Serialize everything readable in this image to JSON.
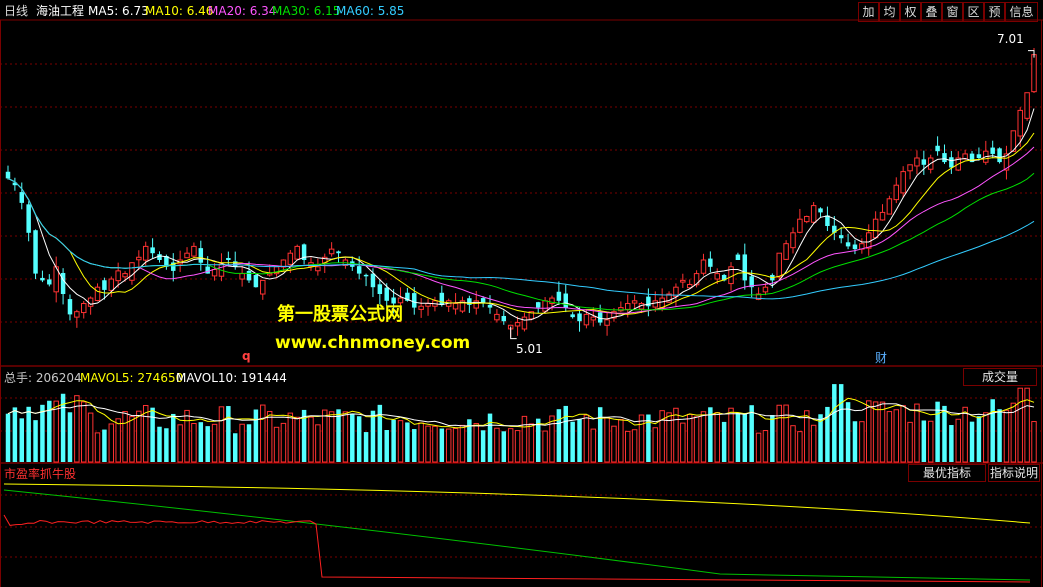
{
  "price_panel": {
    "period": "日线",
    "stock_name": "海油工程",
    "ma_items": [
      {
        "label": "MA5: 6.73",
        "color": "#ffffff"
      },
      {
        "label": "MA10: 6.46",
        "color": "#ffff00"
      },
      {
        "label": "MA20: 6.34",
        "color": "#ff55ff"
      },
      {
        "label": "MA30: 6.15",
        "color": "#00e000"
      },
      {
        "label": "MA60: 5.85",
        "color": "#33ccff"
      }
    ],
    "toolbar": [
      "加",
      "均",
      "权",
      "叠",
      "窗",
      "区",
      "预",
      "信息"
    ],
    "high_label": "7.01",
    "low_label": "5.01",
    "marker_q": "q",
    "marker_cai": "财",
    "axis_max": 7.25,
    "axis_min": 4.75
  },
  "watermark": {
    "line1": "第一股票公式网",
    "line2": "www.chnmoney.com"
  },
  "volume_panel": {
    "total_label": "总手: 206204",
    "mavol5_label": "MAVOL5: 274650",
    "mavol10_label": "MAVOL10: 191444",
    "button": "成交量"
  },
  "indicator_panel": {
    "title": "市盈率抓牛股",
    "best_button": "最优指标",
    "help_button": "指标说明"
  },
  "colors": {
    "up": "#ff3232",
    "down": "#54ffff",
    "grid": "#7a0000",
    "ma5": "#ffffff",
    "ma10": "#ffff00",
    "ma20": "#ff55ff",
    "ma30": "#00e000",
    "ma60": "#33ccff"
  },
  "chart_data": {
    "type": "candlestick",
    "close": [
      6.1,
      6.05,
      5.92,
      5.7,
      5.4,
      5.35,
      5.32,
      5.45,
      5.25,
      5.1,
      5.12,
      5.18,
      5.22,
      5.3,
      5.28,
      5.36,
      5.42,
      5.4,
      5.48,
      5.52,
      5.6,
      5.55,
      5.5,
      5.45,
      5.42,
      5.5,
      5.55,
      5.6,
      5.48,
      5.4,
      5.43,
      5.47,
      5.5,
      5.45,
      5.4,
      5.35,
      5.3,
      5.35,
      5.4,
      5.45,
      5.5,
      5.55,
      5.6,
      5.5,
      5.48,
      5.45,
      5.52,
      5.58,
      5.55,
      5.5,
      5.45,
      5.4,
      5.38,
      5.3,
      5.25,
      5.2,
      5.18,
      5.22,
      5.2,
      5.15,
      5.16,
      5.18,
      5.2,
      5.17,
      5.2,
      5.18,
      5.2,
      5.17,
      5.2,
      5.18,
      5.15,
      5.1,
      5.05,
      5.02,
      5.04,
      5.08,
      5.12,
      5.15,
      5.2,
      5.22,
      5.2,
      5.15,
      5.08,
      5.05,
      5.1,
      5.08,
      5.04,
      5.06,
      5.12,
      5.15,
      5.18,
      5.2,
      5.18,
      5.16,
      5.2,
      5.22,
      5.25,
      5.3,
      5.35,
      5.32,
      5.4,
      5.5,
      5.45,
      5.4,
      5.35,
      5.45,
      5.5,
      5.35,
      5.3,
      5.25,
      5.3,
      5.35,
      5.55,
      5.62,
      5.7,
      5.8,
      5.82,
      5.9,
      5.85,
      5.75,
      5.7,
      5.66,
      5.6,
      5.58,
      5.62,
      5.7,
      5.8,
      5.85,
      5.95,
      6.05,
      6.15,
      6.2,
      6.25,
      6.2,
      6.25,
      6.3,
      6.22,
      6.18,
      6.25,
      6.28,
      6.22,
      6.25,
      6.3,
      6.28,
      6.22,
      6.28,
      6.45,
      6.6,
      6.73,
      7.01
    ],
    "highest": 7.01,
    "lowest": 5.01,
    "ma5": 6.73,
    "ma10": 6.46,
    "ma20": 6.34,
    "ma30": 6.15,
    "ma60": 5.85,
    "volume_total": 206204,
    "mavol5": 274650,
    "mavol10": 191444
  }
}
